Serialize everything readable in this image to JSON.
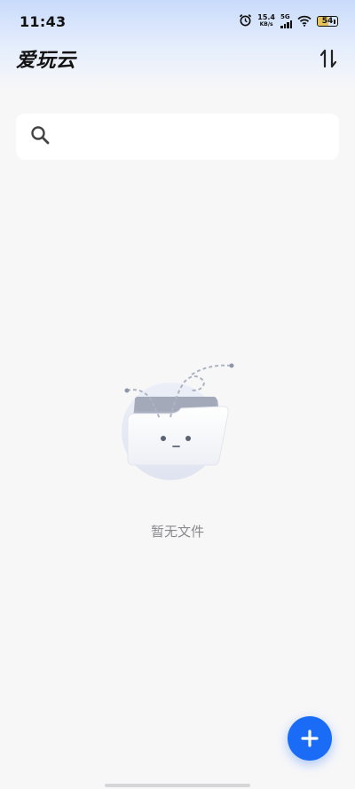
{
  "status_bar": {
    "time": "11:43",
    "net_speed_value": "15.4",
    "net_speed_unit": "KB/s",
    "network_type": "5G",
    "battery_level": "54",
    "battery_fraction": 0.54
  },
  "header": {
    "title": "爱玩云",
    "sort_icon": "sort-arrows-icon"
  },
  "search": {
    "placeholder": "",
    "value": "",
    "icon": "search-icon"
  },
  "empty_state": {
    "illustration": "empty-folder-illustration",
    "message": "暂无文件"
  },
  "fab": {
    "icon": "plus-icon",
    "color": "#1a6cf6"
  }
}
